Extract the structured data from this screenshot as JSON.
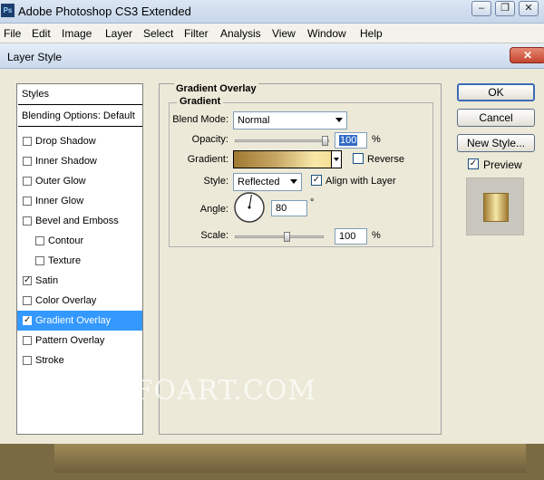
{
  "app": {
    "logo_text": "Ps",
    "title": "Adobe Photoshop CS3 Extended",
    "window_controls": {
      "minimize": "–",
      "restore": "❐",
      "close": "✕"
    }
  },
  "menu": [
    "File",
    "Edit",
    "Image",
    "Layer",
    "Select",
    "Filter",
    "Analysis",
    "View",
    "Window",
    "Help"
  ],
  "dialog": {
    "title": "Layer Style",
    "close_glyph": "✕",
    "styles_header": "Styles",
    "blending_options": "Blending Options: Default",
    "styles": [
      {
        "label": "Drop Shadow",
        "checked": false,
        "selected": false
      },
      {
        "label": "Inner Shadow",
        "checked": false,
        "selected": false
      },
      {
        "label": "Outer Glow",
        "checked": false,
        "selected": false
      },
      {
        "label": "Inner Glow",
        "checked": false,
        "selected": false
      },
      {
        "label": "Bevel and Emboss",
        "checked": false,
        "selected": false
      },
      {
        "label": "Contour",
        "checked": false,
        "selected": false
      },
      {
        "label": "Texture",
        "checked": false,
        "selected": false
      },
      {
        "label": "Satin",
        "checked": true,
        "selected": false
      },
      {
        "label": "Color Overlay",
        "checked": false,
        "selected": false
      },
      {
        "label": "Gradient Overlay",
        "checked": true,
        "selected": true
      },
      {
        "label": "Pattern Overlay",
        "checked": false,
        "selected": false
      },
      {
        "label": "Stroke",
        "checked": false,
        "selected": false
      }
    ],
    "panel": {
      "title": "Gradient Overlay",
      "group_title": "Gradient",
      "blend_mode_label": "Blend Mode:",
      "blend_mode_value": "Normal",
      "opacity_label": "Opacity:",
      "opacity_value": "100",
      "opacity_unit": "%",
      "opacity_level": 1.0,
      "gradient_label": "Gradient:",
      "reverse_label": "Reverse",
      "reverse_checked": false,
      "style_label": "Style:",
      "style_value": "Reflected",
      "align_label": "Align with Layer",
      "align_checked": true,
      "angle_label": "Angle:",
      "angle_value": "80",
      "angle_unit": "°",
      "scale_label": "Scale:",
      "scale_value": "100",
      "scale_unit": "%",
      "scale_level": 0.6
    },
    "buttons": {
      "ok": "OK",
      "cancel": "Cancel",
      "new_style": "New Style...",
      "preview_label": "Preview",
      "preview_checked": true
    }
  },
  "watermark": "ALFOART.COM",
  "colors": {
    "selection": "#3399ff",
    "gradient_dark": "#a07a32",
    "gradient_light": "#f7e8a8"
  }
}
